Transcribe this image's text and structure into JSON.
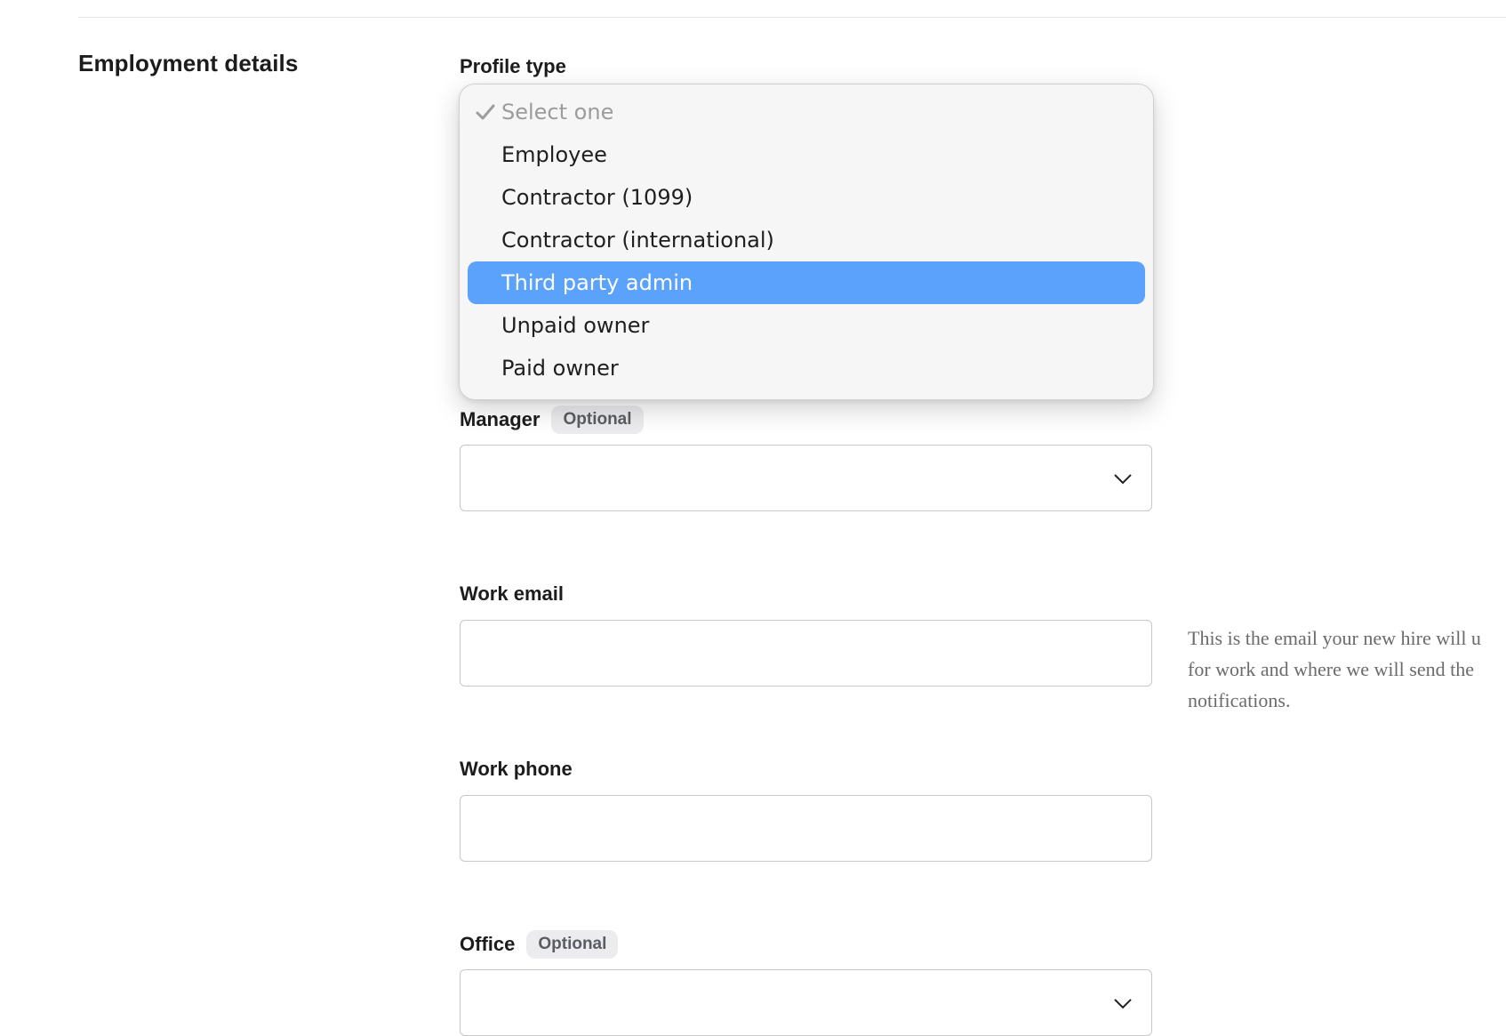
{
  "section": {
    "title": "Employment details"
  },
  "fields": {
    "profile_type": {
      "label": "Profile type",
      "options": [
        "Select one",
        "Employee",
        "Contractor (1099)",
        "Contractor (international)",
        "Third party admin",
        "Unpaid owner",
        "Paid owner"
      ],
      "checked_option": "Select one",
      "highlighted_option": "Third party admin"
    },
    "manager": {
      "label": "Manager",
      "badge": "Optional",
      "value": ""
    },
    "work_email": {
      "label": "Work email",
      "value": "",
      "help": "This is the email your new hire will u\nfor work and where we will send the\nnotifications."
    },
    "work_phone": {
      "label": "Work phone",
      "value": ""
    },
    "office": {
      "label": "Office",
      "badge": "Optional",
      "value": ""
    }
  },
  "icons": {
    "dropdown_chevron": "chevron-down-icon",
    "selected_check": "check-icon"
  },
  "colors": {
    "highlight": "#5aa2fb",
    "badge_bg": "#ececee",
    "help_text": "#6b6b6b"
  }
}
